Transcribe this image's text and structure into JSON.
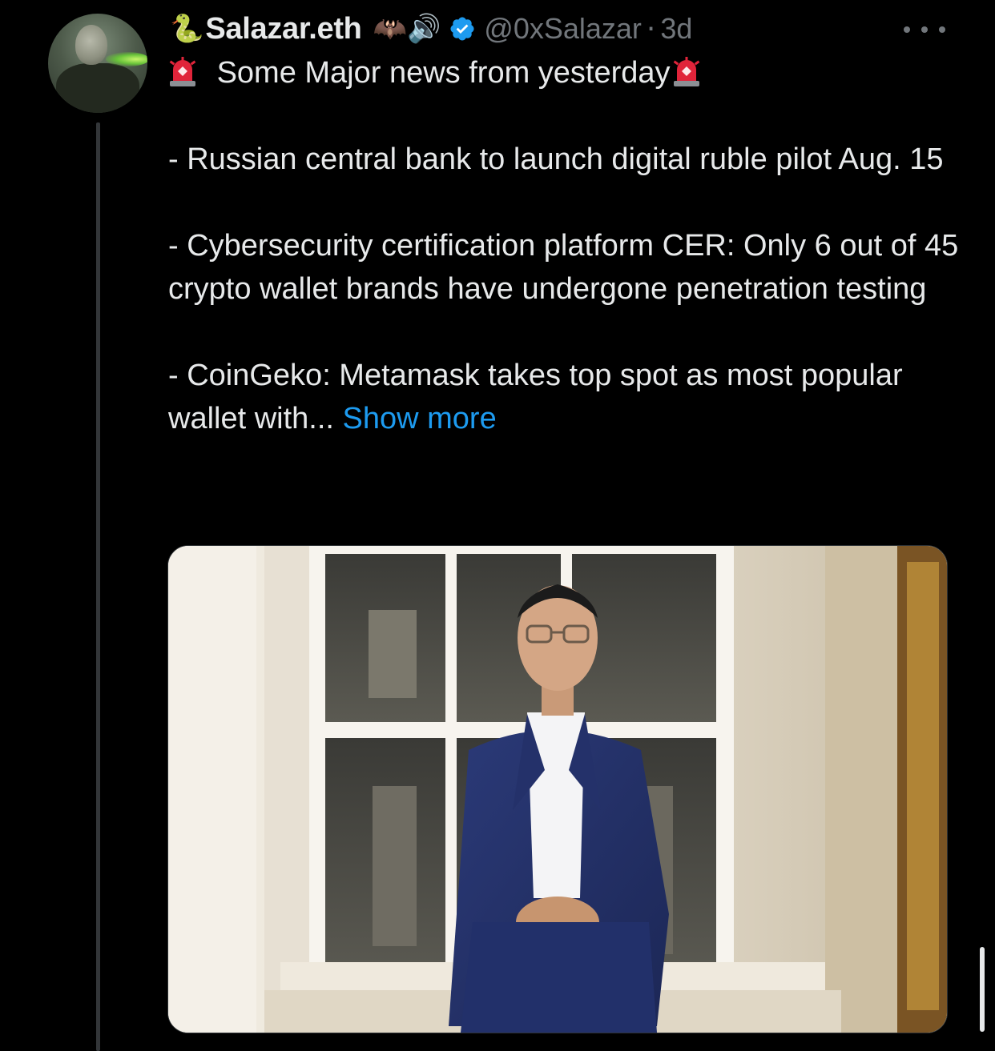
{
  "tweet": {
    "name_prefix_emoji": "🐍",
    "display_name": "Salazar.eth",
    "name_emojis": "🦇🔊",
    "handle": "@0xSalazar",
    "separator": "·",
    "time": "3d",
    "headline": "Some Major news from yesterday",
    "items": [
      "- Russian central bank to launch digital ruble pilot Aug. 15",
      "- Cybersecurity certification platform CER: Only 6 out of 45 crypto wallet brands have undergone penetration testing",
      "- CoinGeko: Metamask takes top spot as most popular wallet with..."
    ],
    "show_more": "Show more"
  },
  "icons": {
    "verified": "verified-badge-icon",
    "siren": "police-siren-emoji",
    "more": "more-dots-icon"
  },
  "colors": {
    "background": "#000000",
    "text": "#e7e9ea",
    "muted": "#71767b",
    "link": "#1d9bf0",
    "verified": "#1d9bf0"
  }
}
